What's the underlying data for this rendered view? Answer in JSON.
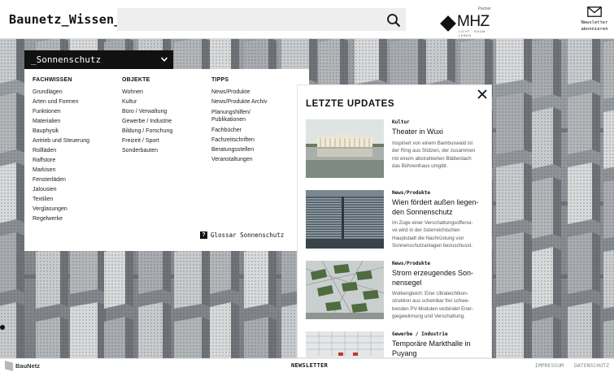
{
  "header": {
    "logo": "Baunetz_Wissen_",
    "search_placeholder": "",
    "partner": {
      "label": "Partner",
      "name": "MHZ",
      "tagline": "LICHT · RAUM · LEBEN"
    },
    "newsletter_label_1": "Newsletter",
    "newsletter_label_2": "abonnieren"
  },
  "topic_select": {
    "label": "_Sonnenschutz"
  },
  "menu": {
    "columns": [
      {
        "heading": "FACHWISSEN",
        "items": [
          "Grundlagen",
          "Arten und Formen",
          "Funktionen",
          "Materialien",
          "Bauphysik",
          "Antrieb und Steuerung",
          "Rollläden",
          "Raffstore",
          "Markisen",
          "Fensterläden",
          "Jalousien",
          "Textilien",
          "Verglasungen",
          "Regelwerke"
        ]
      },
      {
        "heading": "OBJEKTE",
        "items": [
          "Wohnen",
          "Kultur",
          "Büro / Verwaltung",
          "Gewerbe / Industrie",
          "Bildung / Forschung",
          "Freizeit / Sport",
          "Sonderbauten"
        ]
      },
      {
        "heading": "TIPPS",
        "items": [
          "News/Produkte",
          "News/Produkte Archiv",
          "Planungshilfen/",
          "Publikationen",
          "Fachbücher",
          "Fachzeitschriften",
          "Beratungsstellen",
          "Veranstaltungen"
        ]
      }
    ],
    "glossar_label": "Glossar Sonnenschutz",
    "glossar_icon": "?"
  },
  "updates": {
    "title": "LETZTE UPDATES",
    "cards": [
      {
        "category": "Kultur",
        "title": "Theater in Wuxi",
        "desc_lines": [
          "Inspiriert von einem Bambuswald ist",
          "der Ring aus Stützen, der zusammen",
          "mit einem abstrahierten Blätterdach",
          "das Bühnenhaus umgibt."
        ]
      },
      {
        "category": "News/Produkte",
        "title_lines": [
          "Wien fördert außen liegen-",
          "den Sonnenschutz"
        ],
        "desc_lines": [
          "Im Zuge einer Verschattungsoffensi-",
          "ve wird in der österreichischen",
          "Hauptstadt die Nachrüstung von",
          "Sonnenschutzanlagen bezuschusst."
        ]
      },
      {
        "category": "News/Produkte",
        "title_lines": [
          "Strom erzeugendes Son-",
          "nensegel"
        ],
        "desc_lines": [
          "Wolkengleich: Eine Ultraleichtkon-",
          "struktion aus scheinbar frei schwe-",
          "benden PV-Modulen verbindet Ener-",
          "giegewinnung und Verschattung."
        ]
      },
      {
        "category": "Gewerbe / Industrie",
        "title_lines": [
          "Temporäre Markthalle in",
          "Puyang"
        ]
      }
    ]
  },
  "footer": {
    "brand": "BauNetz",
    "newsletter": "NEWSLETTER",
    "impressum": "IMPRESSUM",
    "datenschutz": "DATENSCHUTZ"
  }
}
